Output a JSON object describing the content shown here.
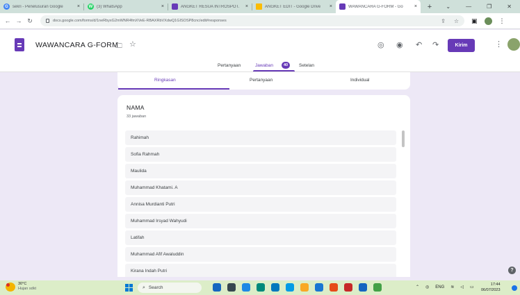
{
  "browser": {
    "tabs": [
      {
        "title": "sekri - Penelusuran Google",
        "icon_color": "#4285f4",
        "icon_glyph": "G",
        "active": false
      },
      {
        "title": "(3) WhatsApp",
        "icon_color": "#25d366",
        "icon_glyph": "W",
        "active": false
      },
      {
        "title": "ANGKET RESUA INTROSPOT.",
        "icon_color": "#673ab7",
        "icon_glyph": "",
        "active": false
      },
      {
        "title": "ANGKET EDIT - Google Drive",
        "icon_color": "#fbbc04",
        "icon_glyph": "",
        "active": false
      },
      {
        "title": "WAWANCARA G-FORM - Go",
        "icon_color": "#673ab7",
        "icon_glyph": "",
        "active": true
      }
    ],
    "url": "docs.google.com/forms/d/1neRbyxG2mWNR4fmXVeE-RBAXRbVXdwQ1GISOSP8cnc/edit#responses"
  },
  "form": {
    "title": "WAWANCARA G-FORM",
    "send_label": "Kirim",
    "tabs": {
      "questions": "Pertanyaan",
      "responses": "Jawaban",
      "response_count": "40",
      "settings": "Setelan"
    },
    "subtabs": {
      "summary": "Ringkasan",
      "question": "Pertanyaan",
      "individual": "Individual"
    }
  },
  "question": {
    "title": "NAMA",
    "response_count_label": "33 jawaban",
    "answers": [
      "Rahimah",
      "Sofia Rahmah",
      "Maulida",
      "Muhammad Khatami. A",
      "Annisa Murdianti Putri",
      "Muhammad Irsyad Wahyudi",
      "Latifah",
      "Muhammad Afif Awaluddin",
      "Kirana Indah Putri"
    ]
  },
  "taskbar": {
    "weather_temp": "30°C",
    "weather_desc": "Hujan sdkt",
    "search_placeholder": "Search",
    "language": "ENG",
    "time": "17:44",
    "date": "06/07/2023",
    "app_colors": [
      "#1565c0",
      "#37474f",
      "#1e88e5",
      "#00897b",
      "#0277bd",
      "#039be5",
      "#f9a825",
      "#1976d2",
      "#e64a19",
      "#c62828",
      "#1565c0",
      "#43a047"
    ]
  },
  "colors": {
    "brand_purple": "#673ab7",
    "page_bg": "#ede8f6"
  }
}
